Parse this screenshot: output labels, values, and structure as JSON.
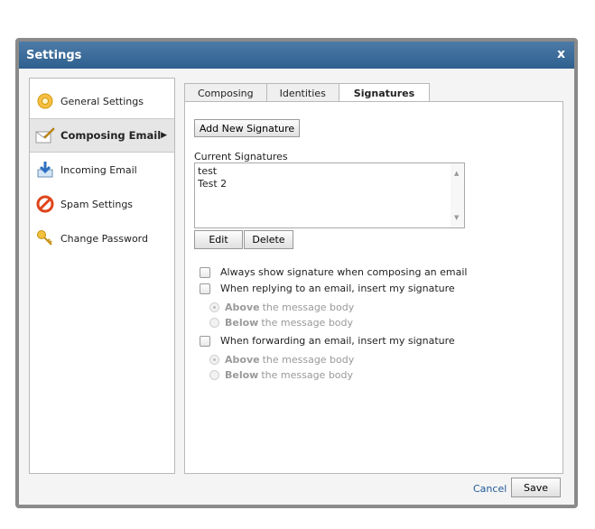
{
  "window": {
    "title": "Settings",
    "close_label": "x"
  },
  "sidebar": {
    "items": [
      {
        "label": "General Settings",
        "icon": "gear-icon"
      },
      {
        "label": "Composing Email",
        "icon": "compose-icon",
        "active": true
      },
      {
        "label": "Incoming Email",
        "icon": "inbox-download-icon"
      },
      {
        "label": "Spam Settings",
        "icon": "no-entry-icon"
      },
      {
        "label": "Change Password",
        "icon": "key-icon"
      }
    ]
  },
  "tabs": [
    {
      "label": "Composing"
    },
    {
      "label": "Identities"
    },
    {
      "label": "Signatures",
      "active": true
    }
  ],
  "signatures": {
    "add_button": "Add New Signature",
    "list_label": "Current Signatures",
    "list": [
      "test",
      "Test 2"
    ],
    "edit_button": "Edit",
    "delete_button": "Delete"
  },
  "options": {
    "always_show": "Always show signature when composing an email",
    "reply_insert": "When replying to an email, insert my signature",
    "forward_insert": "When forwarding an email, insert my signature",
    "above_bold": "Above",
    "below_bold": "Below",
    "position_suffix": "the message body"
  },
  "footer": {
    "cancel": "Cancel",
    "save": "Save"
  }
}
